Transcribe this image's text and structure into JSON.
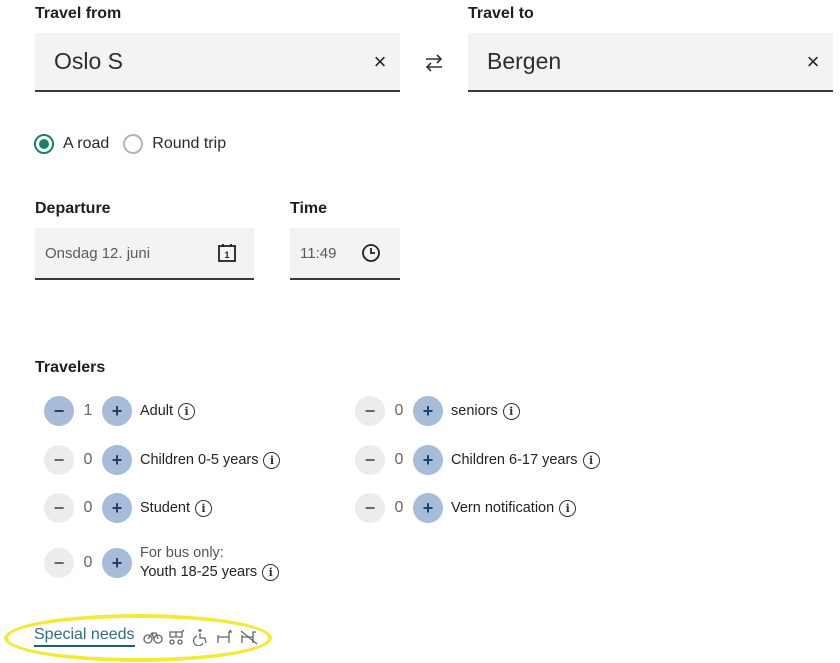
{
  "from": {
    "label": "Travel from",
    "value": "Oslo S",
    "clear_icon": "close-icon"
  },
  "to": {
    "label": "Travel to",
    "value": "Bergen",
    "clear_icon": "close-icon"
  },
  "swap_icon": "swap-arrows-icon",
  "trip_type": {
    "options": [
      {
        "label": "A road",
        "checked": true
      },
      {
        "label": "Round trip",
        "checked": false
      }
    ]
  },
  "departure": {
    "label": "Departure",
    "value": "Onsdag 12. juni",
    "icon": "calendar-icon",
    "icon_text": "1"
  },
  "time": {
    "label": "Time",
    "value": "11:49",
    "icon": "clock-icon"
  },
  "travelers": {
    "title": "Travelers",
    "minus_symbol": "−",
    "plus_symbol": "+",
    "info_symbol": "i",
    "items": [
      {
        "label": "Adult",
        "count": "1"
      },
      {
        "label": "seniors",
        "count": "0"
      },
      {
        "label": "Children 0-5 years",
        "count": "0"
      },
      {
        "label": "Children 6-17 years",
        "count": "0"
      },
      {
        "label": "Student",
        "count": "0"
      },
      {
        "label": "Vern notification",
        "count": "0"
      },
      {
        "label_line1": "For bus only:",
        "label_line2": "Youth 18-25 years",
        "count": "0"
      }
    ]
  },
  "special_needs": {
    "label": "Special needs",
    "icons": [
      "bicycle-icon",
      "stroller-icon",
      "wheelchair-icon",
      "dog-icon",
      "no-animal-icon"
    ]
  },
  "colors": {
    "accent_green": "#17826b",
    "stepper_blue": "#a6bcd8",
    "link_color": "#2b6e86",
    "highlight_yellow": "#f2ea3a"
  }
}
